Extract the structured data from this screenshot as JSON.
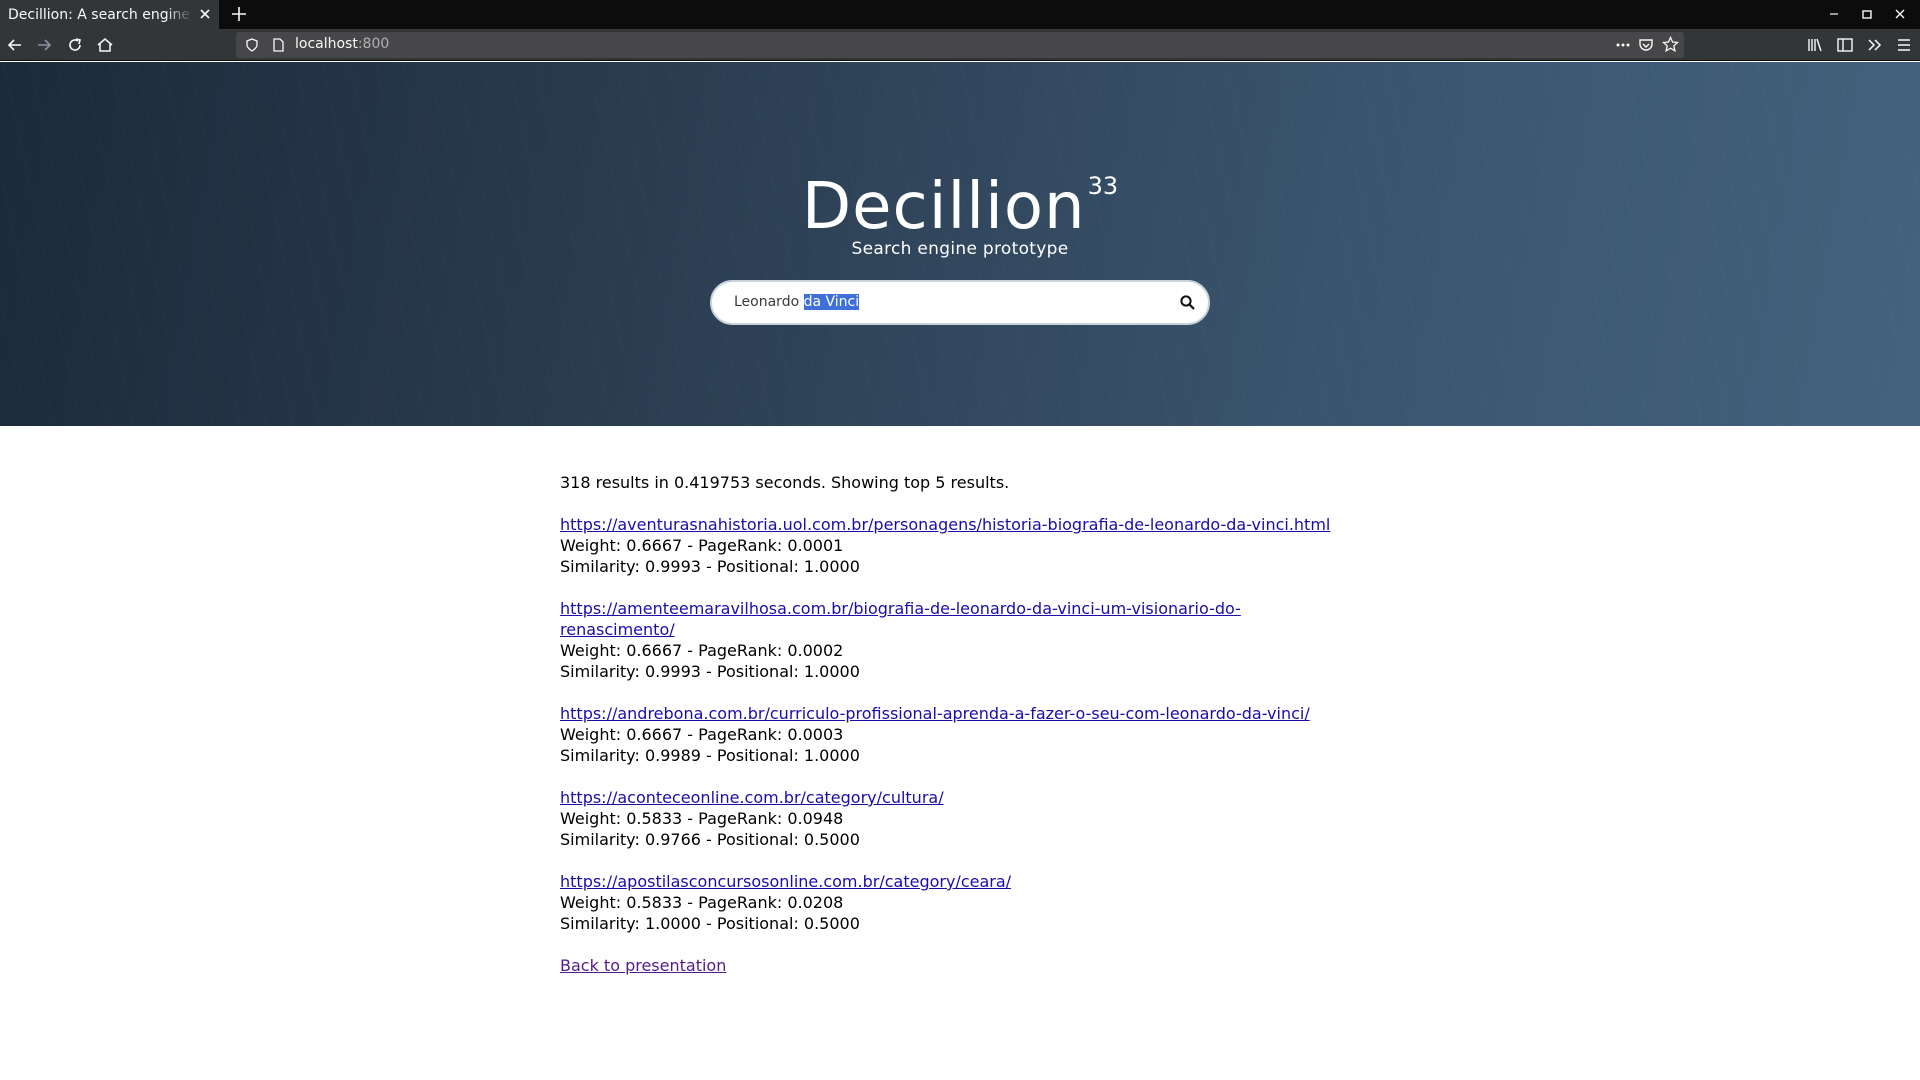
{
  "browser": {
    "tab_title": "Decillion: A search engine p",
    "url_host": "localhost",
    "url_port": ":800"
  },
  "hero": {
    "title": "Decillion",
    "superscript": "33",
    "subtitle": "Search engine prototype"
  },
  "search": {
    "value_prefix": "Leonardo ",
    "value_selected": "da Vinci"
  },
  "results": {
    "summary": "318 results in 0.419753 seconds. Showing top 5 results.",
    "items": [
      {
        "url": "https://aventurasnahistoria.uol.com.br/personagens/historia-biografia-de-leonardo-da-vinci.html",
        "line1": "Weight: 0.6667 - PageRank: 0.0001",
        "line2": "Similarity: 0.9993 - Positional: 1.0000"
      },
      {
        "url": "https://amenteemaravilhosa.com.br/biografia-de-leonardo-da-vinci-um-visionario-do-renascimento/",
        "line1": "Weight: 0.6667 - PageRank: 0.0002",
        "line2": "Similarity: 0.9993 - Positional: 1.0000"
      },
      {
        "url": "https://andrebona.com.br/curriculo-profissional-aprenda-a-fazer-o-seu-com-leonardo-da-vinci/",
        "line1": "Weight: 0.6667 - PageRank: 0.0003",
        "line2": "Similarity: 0.9989 - Positional: 1.0000"
      },
      {
        "url": "https://aconteceonline.com.br/category/cultura/",
        "line1": "Weight: 0.5833 - PageRank: 0.0948",
        "line2": "Similarity: 0.9766 - Positional: 0.5000"
      },
      {
        "url": "https://apostilasconcursosonline.com.br/category/ceara/",
        "line1": "Weight: 0.5833 - PageRank: 0.0208",
        "line2": "Similarity: 1.0000 - Positional: 0.5000"
      }
    ],
    "back_link": "Back to presentation"
  }
}
